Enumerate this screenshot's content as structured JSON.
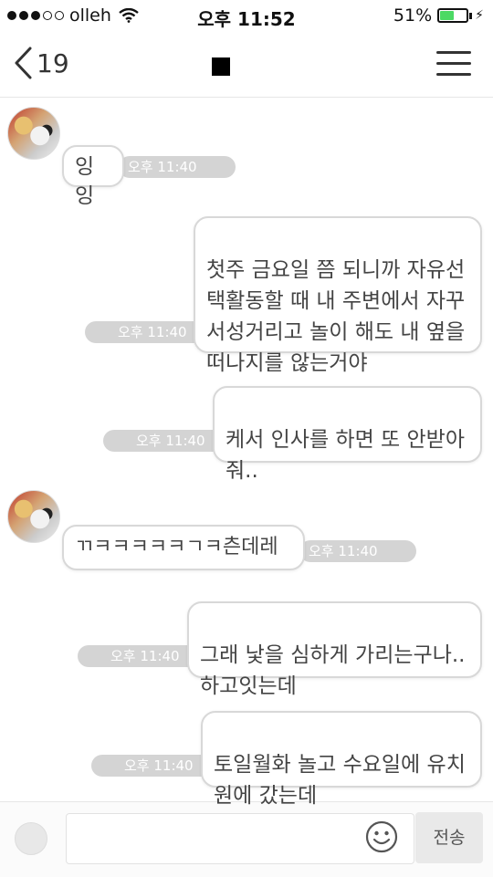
{
  "status_bar": {
    "carrier": "olleh",
    "time": "오후 11:52",
    "battery": "51%"
  },
  "nav": {
    "back_count": "19"
  },
  "messages": [
    {
      "text": "잉잉",
      "time": "오후 11:40"
    },
    {
      "text": "첫주 금요일 쯤 되니까 자유선\n택활동할 때 내 주변에서 자꾸\n서성거리고 놀이 해도 내 옆을\n떠나지를 않는거야",
      "time": "오후 11:40"
    },
    {
      "text": "케서 인사를 하면 또 안받아\n줘..",
      "time": "오후 11:40"
    },
    {
      "text": "ㄲㅋㅋㅋㅋㅋㄱㅋ츤데레",
      "time": "오후 11:40"
    },
    {
      "text": "그래 낯을 심하게 가리는구나..\n하고잇는데",
      "time": "오후 11:40"
    },
    {
      "text": "토일월화 놀고 수요일에 유치\n원에 갔는데",
      "time": "오후 11:40"
    }
  ],
  "input": {
    "send_label": "전송"
  },
  "colors": {
    "battery_fill": "#4cd964",
    "bubble_border": "#d8d8d8",
    "time_pill": "#d4d4d4"
  }
}
